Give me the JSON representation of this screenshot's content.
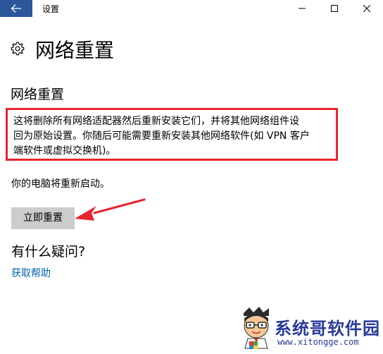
{
  "window": {
    "title": "设置",
    "back_icon": "arrow-left-icon",
    "accent_color": "#2b579a"
  },
  "page": {
    "title": "网络重置",
    "icon": "gear-icon"
  },
  "main": {
    "section_heading": "网络重置",
    "description_line1": "这将删除所有网络适配器然后重新安装它们，并将其他网络组件设",
    "description_line2": "回为原始设置。你随后可能需要重新安装其他网络软件(如 VPN 客户",
    "description_line3": "端软件或虚拟交换机)。",
    "restart_note": "你的电脑将重新启动。",
    "reset_button_label": "立即重置",
    "faq_heading": "有什么疑问?",
    "help_link_label": "获取帮助",
    "highlight_color": "#e6252e",
    "link_color": "#0063b1"
  },
  "watermark": {
    "title": "系统哥软件园",
    "url": "www.xitongge.com"
  }
}
